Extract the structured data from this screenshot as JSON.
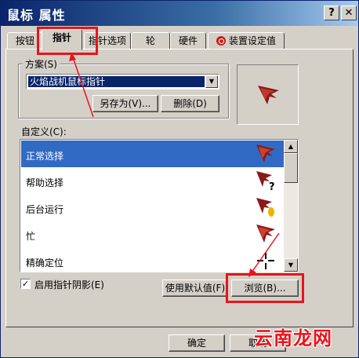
{
  "window": {
    "title": "鼠标 属性",
    "help_button": "?",
    "close_button": "✕"
  },
  "tabs": [
    {
      "label": "按钮",
      "active": false
    },
    {
      "label": "指针",
      "active": true
    },
    {
      "label": "指针选项",
      "active": false
    },
    {
      "label": "轮",
      "active": false
    },
    {
      "label": "硬件",
      "active": false
    },
    {
      "label": "装置设定值",
      "active": false,
      "icon": "device-settings-icon"
    }
  ],
  "scheme": {
    "label": "方案(S)",
    "selected": "火焰战机鼠标指针",
    "save_as_button": "另存为(V)...",
    "delete_button": "删除(D)"
  },
  "custom": {
    "label": "自定义(C):",
    "items": [
      {
        "label": "正常选择",
        "selected": true,
        "icon": "fighter-jet-cursor-icon"
      },
      {
        "label": "帮助选择",
        "selected": false,
        "icon": "fighter-jet-help-cursor-icon"
      },
      {
        "label": "后台运行",
        "selected": false,
        "icon": "fighter-jet-busy-cursor-icon"
      },
      {
        "label": "忙",
        "selected": false,
        "icon": "fighter-jet-cursor-icon"
      },
      {
        "label": "精确定位",
        "selected": false,
        "icon": "crosshair-cursor-icon"
      }
    ]
  },
  "shadow_checkbox": {
    "label": "启用指针阴影(E)",
    "checked": true
  },
  "buttons": {
    "use_default": "使用默认值(F)",
    "browse": "浏览(B)...",
    "ok": "确定",
    "cancel": "取消"
  },
  "watermark": "云南龙网",
  "colors": {
    "title_gradient_start": "#0a246a",
    "title_gradient_end": "#a6caf0",
    "selection": "#316ac5",
    "annotation_red": "#e8141c",
    "dialog_face": "#d4d0c8"
  }
}
